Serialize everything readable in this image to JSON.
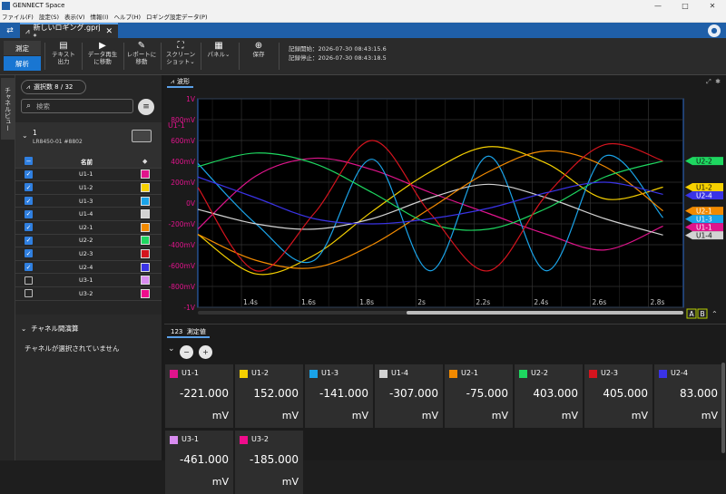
{
  "window": {
    "title": "GENNECT Space"
  },
  "menu": [
    "ファイル(F)",
    "設定(S)",
    "表示(V)",
    "情報(I)",
    "ヘルプ(H)",
    "ロギング設定データ(P)"
  ],
  "tab": {
    "name": "新しいロギング.gprj *"
  },
  "toolbar": {
    "mode_measure": "測定",
    "mode_analyze": "解析",
    "text_output": "テキスト",
    "text_output_sub": "出力",
    "data_replay": "データ再生",
    "data_replay_sub": "に移動",
    "report": "レポートに",
    "report_sub": "移動",
    "screenshot": "スクリーン",
    "screenshot_sub": "ショット",
    "panel": "パネル",
    "save": "保存",
    "rec_start": "記録開始：2026-07-30 08:43:15.6",
    "rec_stop": "記録停止：2026-07-30 08:43:18.5"
  },
  "side": {
    "vtab": "チャネルビュー",
    "selected_count": "選択数 8 / 32",
    "search_placeholder": "検索",
    "device_number": "1",
    "device_model": "LR8450-01 #8802",
    "col_name": "名前",
    "channels": [
      {
        "name": "U1-1",
        "checked": true,
        "color": "#e0148c"
      },
      {
        "name": "U1-2",
        "checked": true,
        "color": "#f5d000"
      },
      {
        "name": "U1-3",
        "checked": true,
        "color": "#1aa3e8"
      },
      {
        "name": "U1-4",
        "checked": true,
        "color": "#d2d2d2"
      },
      {
        "name": "U2-1",
        "checked": true,
        "color": "#f28a00"
      },
      {
        "name": "U2-2",
        "checked": true,
        "color": "#1ed760"
      },
      {
        "name": "U2-3",
        "checked": true,
        "color": "#d4141e"
      },
      {
        "name": "U2-4",
        "checked": true,
        "color": "#3a33e6"
      },
      {
        "name": "U3-1",
        "checked": false,
        "color": "#d88cf0"
      },
      {
        "name": "U3-2",
        "checked": false,
        "color": "#f00c8c"
      }
    ],
    "calc_title": "チャネル間演算",
    "calc_msg": "チャネルが選択されていません"
  },
  "wave": {
    "tab": "波形",
    "channel_label": "U1-1",
    "y_ticks": [
      "1V",
      "800mV",
      "600mV",
      "400mV",
      "200mV",
      "0V",
      "-200mV",
      "-400mV",
      "-600mV",
      "-800mV",
      "-1V"
    ],
    "x_ticks": [
      "1.4s",
      "1.6s",
      "1.8s",
      "2s",
      "2.2s",
      "2.4s",
      "2.6s",
      "2.8s"
    ],
    "cursor_a": "A",
    "cursor_b": "B"
  },
  "chart_data": {
    "type": "line",
    "xlabel": "",
    "ylabel": "",
    "ylim_mV": [
      -1000,
      1000
    ],
    "x": [
      1.25,
      1.45,
      1.65,
      1.85,
      2.05,
      2.25,
      2.45,
      2.65,
      2.85
    ],
    "series": [
      {
        "name": "U1-1",
        "color": "#e0148c",
        "values": [
          -250,
          260,
          430,
          320,
          100,
          -100,
          -300,
          -450,
          -221
        ]
      },
      {
        "name": "U1-2",
        "color": "#f5d000",
        "values": [
          -300,
          -680,
          -500,
          -80,
          300,
          540,
          380,
          40,
          152
        ]
      },
      {
        "name": "U1-3",
        "color": "#1aa3e8",
        "values": [
          380,
          -200,
          -550,
          420,
          -650,
          450,
          -650,
          450,
          -141
        ]
      },
      {
        "name": "U1-4",
        "color": "#d2d2d2",
        "values": [
          -60,
          -200,
          -250,
          -150,
          50,
          180,
          50,
          -150,
          -307
        ]
      },
      {
        "name": "U2-1",
        "color": "#f28a00",
        "values": [
          -300,
          -550,
          -620,
          -400,
          -50,
          300,
          500,
          350,
          -75
        ]
      },
      {
        "name": "U2-2",
        "color": "#1ed760",
        "values": [
          350,
          480,
          380,
          100,
          -200,
          -250,
          -50,
          250,
          403
        ]
      },
      {
        "name": "U2-3",
        "color": "#d4141e",
        "values": [
          150,
          -650,
          -100,
          600,
          -100,
          -650,
          80,
          560,
          405
        ]
      },
      {
        "name": "U2-4",
        "color": "#3a33e6",
        "values": [
          250,
          50,
          -150,
          -200,
          -150,
          -50,
          100,
          200,
          83
        ]
      }
    ],
    "end_labels": [
      "U2-2",
      "U1-2",
      "U2-4",
      "U2-1",
      "U1-3",
      "U1-1",
      "U1-4"
    ]
  },
  "measure": {
    "tab": "測定値",
    "cards": [
      {
        "name": "U1-1",
        "color": "#e0148c",
        "value": "-221.000",
        "unit": "mV"
      },
      {
        "name": "U1-2",
        "color": "#f5d000",
        "value": "152.000",
        "unit": "mV"
      },
      {
        "name": "U1-3",
        "color": "#1aa3e8",
        "value": "-141.000",
        "unit": "mV"
      },
      {
        "name": "U1-4",
        "color": "#d2d2d2",
        "value": "-307.000",
        "unit": "mV"
      },
      {
        "name": "U2-1",
        "color": "#f28a00",
        "value": "-75.000",
        "unit": "mV"
      },
      {
        "name": "U2-2",
        "color": "#1ed760",
        "value": "403.000",
        "unit": "mV"
      },
      {
        "name": "U2-3",
        "color": "#d4141e",
        "value": "405.000",
        "unit": "mV"
      },
      {
        "name": "U2-4",
        "color": "#3a33e6",
        "value": "83.000",
        "unit": "mV"
      },
      {
        "name": "U3-1",
        "color": "#d88cf0",
        "value": "-461.000",
        "unit": "mV"
      },
      {
        "name": "U3-2",
        "color": "#f00c8c",
        "value": "-185.000",
        "unit": "mV"
      }
    ]
  }
}
